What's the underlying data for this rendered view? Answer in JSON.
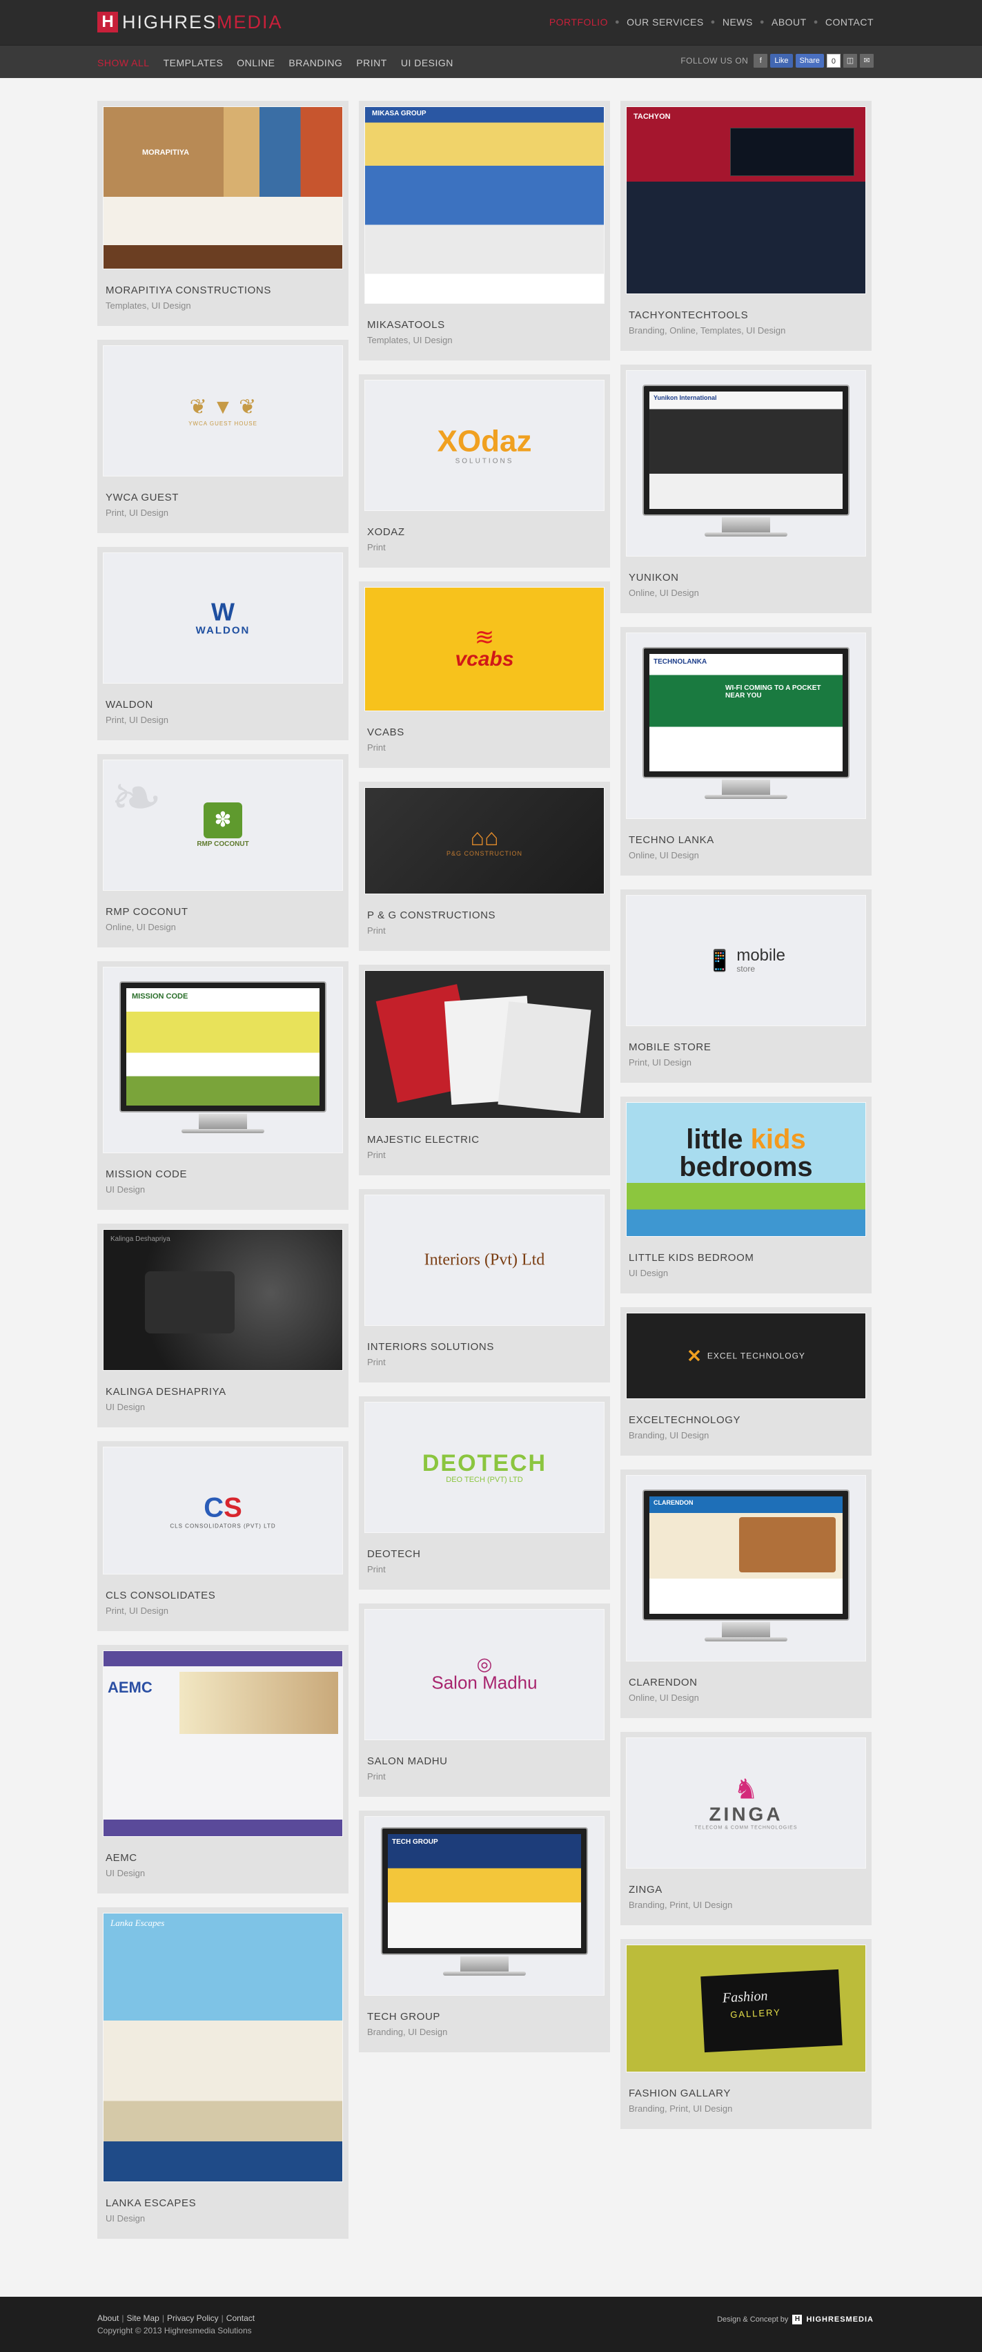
{
  "header": {
    "logo_mark": "H",
    "logo_part1": "HIGHRES",
    "logo_part2": "MEDIA",
    "nav": [
      {
        "label": "PORTFOLIO"
      },
      {
        "label": "OUR SERVICES"
      },
      {
        "label": "NEWS"
      },
      {
        "label": "ABOUT"
      },
      {
        "label": "CONTACT"
      }
    ]
  },
  "filters": {
    "items": [
      {
        "label": "SHOW ALL"
      },
      {
        "label": "TEMPLATES"
      },
      {
        "label": "ONLINE"
      },
      {
        "label": "BRANDING"
      },
      {
        "label": "PRINT"
      },
      {
        "label": "UI DESIGN"
      }
    ]
  },
  "social": {
    "label": "FOLLOW US ON",
    "fb_like": "Like",
    "share": "Share",
    "count": "0"
  },
  "portfolio": {
    "col1": [
      {
        "title": "MORAPITIYA CONSTRUCTIONS",
        "tags": "Templates, UI Design",
        "logo": "MORAPITIYA"
      },
      {
        "title": "YWCA GUEST",
        "tags": "Print, UI Design",
        "logo": "YWCA GUEST HOUSE"
      },
      {
        "title": "WALDON",
        "tags": "Print, UI Design",
        "logo": "WALDON"
      },
      {
        "title": "RMP COCONUT",
        "tags": "Online, UI Design",
        "logo": "RMP COCONUT"
      },
      {
        "title": "MISSION CODE",
        "tags": "UI Design",
        "logo": "MISSION CODE"
      },
      {
        "title": "KALINGA DESHAPRIYA",
        "tags": "UI Design",
        "logo": "Kalinga Deshapriya"
      },
      {
        "title": "CLS CONSOLIDATES",
        "tags": "Print, UI Design",
        "logo": "CLS CONSOLIDATORS (PVT) LTD"
      },
      {
        "title": "AEMC",
        "tags": "UI Design",
        "logo": "AEMC"
      },
      {
        "title": "LANKA ESCAPES",
        "tags": "UI Design",
        "logo": "Lanka Escapes"
      }
    ],
    "col2": [
      {
        "title": "MIKASATOOLS",
        "tags": "Templates, UI Design",
        "logo": "MIKASA GROUP"
      },
      {
        "title": "XODAZ",
        "tags": "Print",
        "logo": "XOdaz",
        "sub": "SOLUTIONS"
      },
      {
        "title": "VCABS",
        "tags": "Print",
        "logo": "vcabs"
      },
      {
        "title": "P & G CONSTRUCTIONS",
        "tags": "Print",
        "logo": "P&G CONSTRUCTION"
      },
      {
        "title": "MAJESTIC ELECTRIC",
        "tags": "Print",
        "logo": ""
      },
      {
        "title": "INTERIORS SOLUTIONS",
        "tags": "Print",
        "logo": "Interiors (Pvt) Ltd"
      },
      {
        "title": "DEOTECH",
        "tags": "Print",
        "logo": "DEOTECH",
        "sub": "DEO TECH (PVT) LTD"
      },
      {
        "title": "SALON MADHU",
        "tags": "Print",
        "logo": "Salon Madhu"
      },
      {
        "title": "TECH GROUP",
        "tags": "Branding, UI Design",
        "logo": "TECH GROUP"
      }
    ],
    "col3": [
      {
        "title": "TACHYONTECHTOOLS",
        "tags": "Branding, Online, Templates, UI Design",
        "logo": "TACHYON"
      },
      {
        "title": "YUNIKON",
        "tags": "Online, UI Design",
        "logo": "Yunikon International"
      },
      {
        "title": "TECHNO LANKA",
        "tags": "Online, UI Design",
        "logo": "TECHNOLANKA",
        "sub": "WI-FI COMING TO A POCKET NEAR YOU"
      },
      {
        "title": "MOBILE STORE",
        "tags": "Print, UI Design",
        "logo": "mobile",
        "sub": "store"
      },
      {
        "title": "LITTLE KIDS BEDROOM",
        "tags": "UI Design",
        "logo": "little",
        "logo2": "kids",
        "sub": "bedrooms"
      },
      {
        "title": "EXCELTECHNOLOGY",
        "tags": "Branding, UI Design",
        "logo": "EXCEL TECHNOLOGY"
      },
      {
        "title": "CLARENDON",
        "tags": "Online, UI Design",
        "logo": "CLARENDON"
      },
      {
        "title": "ZINGA",
        "tags": "Branding, Print, UI Design",
        "logo": "ZINGA",
        "sub": "TELECOM & COMM TECHNOLOGIES"
      },
      {
        "title": "FASHION GALLARY",
        "tags": "Branding, Print, UI Design",
        "logo": "Fashion",
        "sub": "GALLERY"
      }
    ]
  },
  "footer": {
    "links": [
      "About",
      "Site Map",
      "Privacy Policy",
      "Contact"
    ],
    "copyright": "Copyright © 2013 Highresmedia Solutions",
    "credit_label": "Design & Concept by",
    "credit_brand": "HIGHRESMEDIA"
  },
  "colors": {
    "accent": "#c8203a",
    "topbar": "#2c2c2c",
    "card": "#e2e2e2"
  }
}
